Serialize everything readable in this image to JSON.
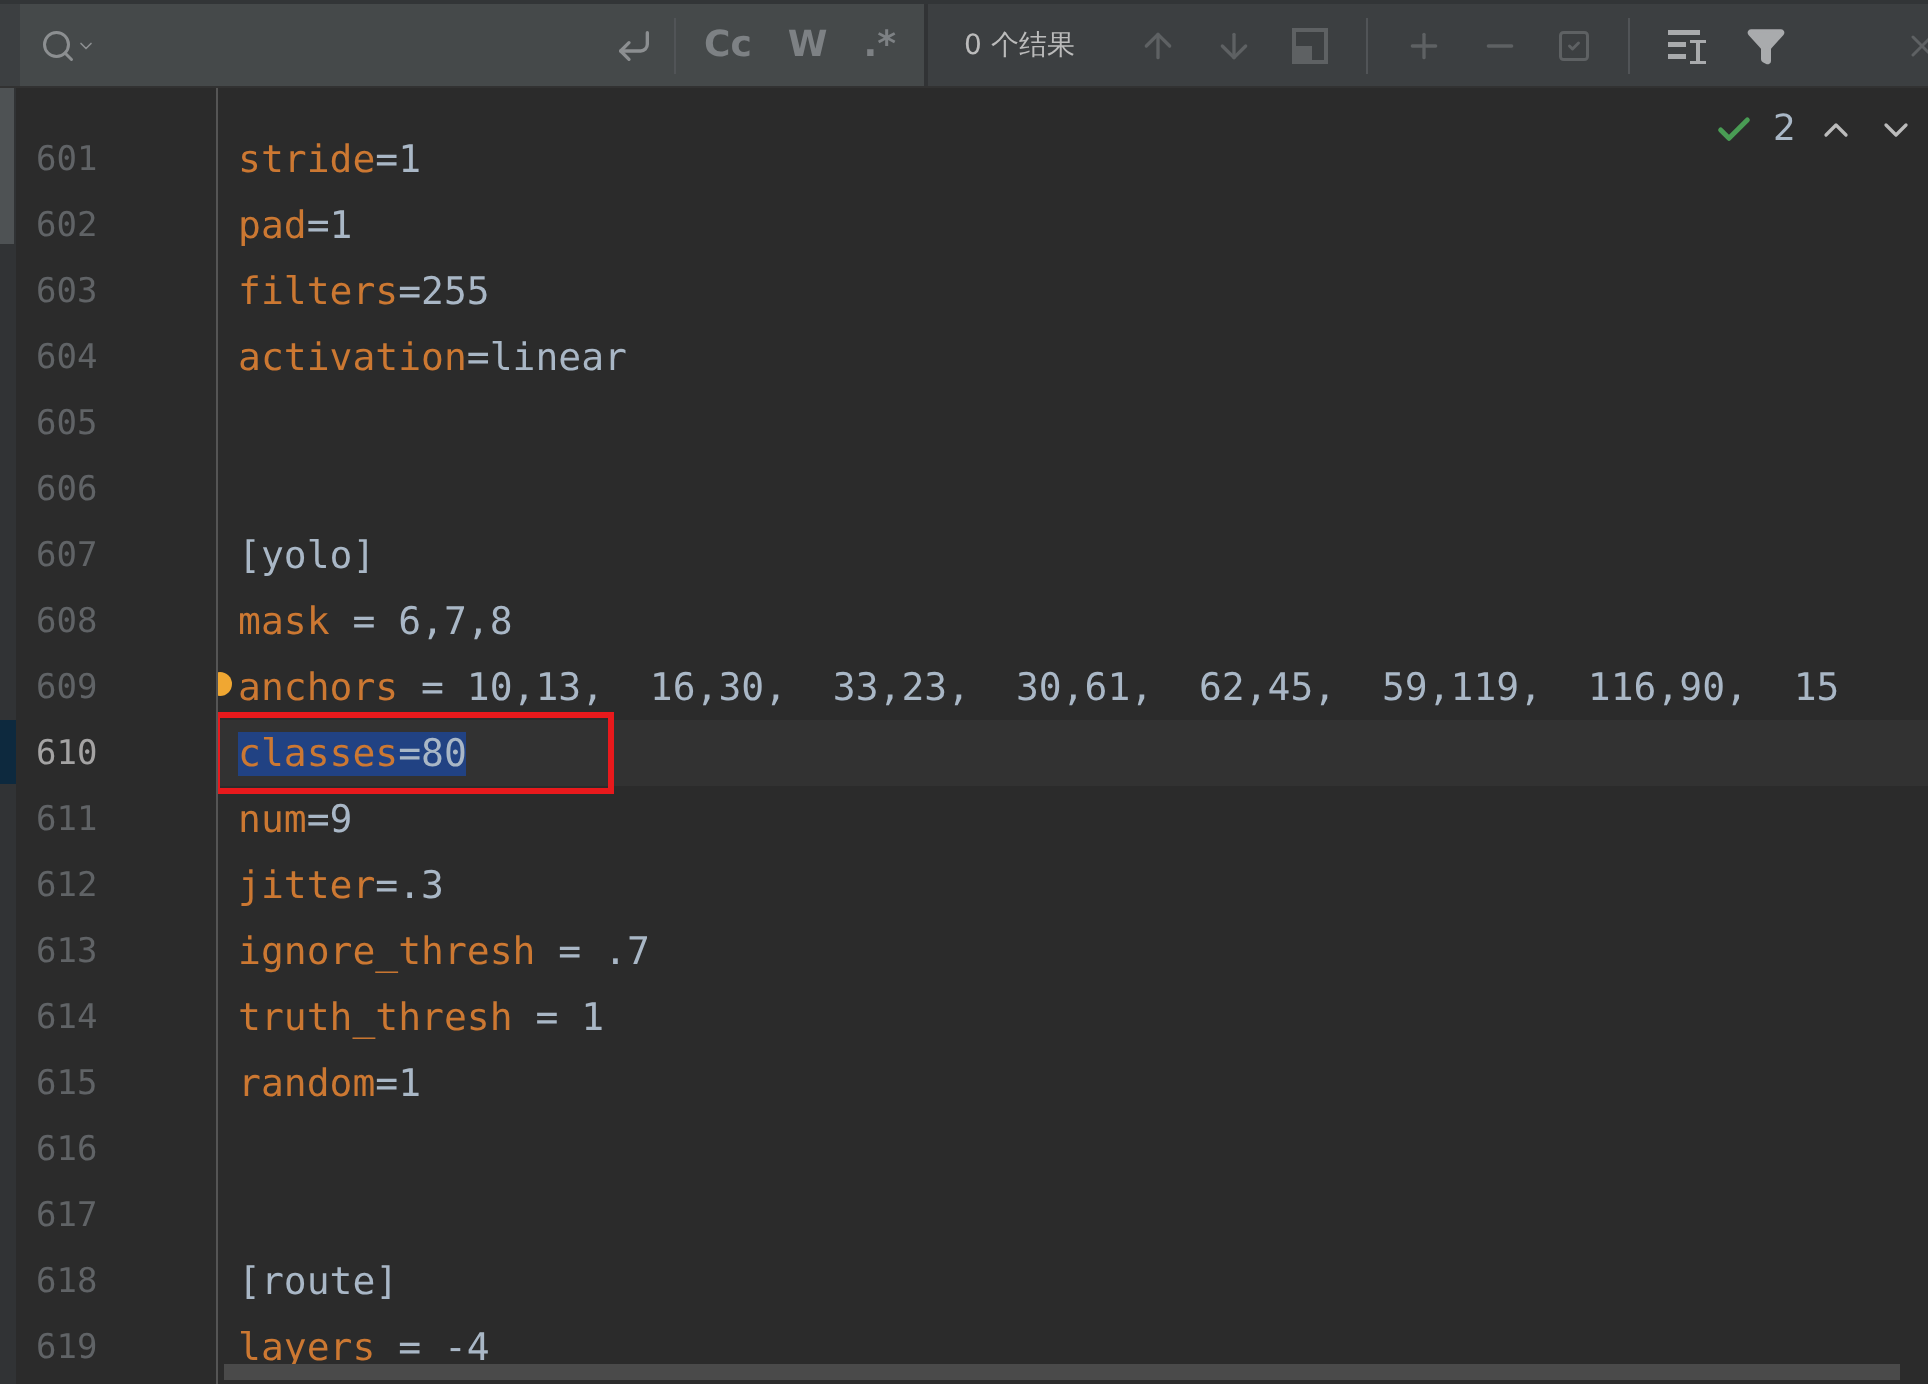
{
  "search_bar": {
    "toggles": [
      {
        "label": "Cc",
        "selected": false
      },
      {
        "label": "W",
        "selected": false
      },
      {
        "label": ".*",
        "selected": false
      }
    ],
    "result_count": "0 个结果"
  },
  "inspection": {
    "count": "2"
  },
  "lines": [
    {
      "number": "601",
      "kind": "pair",
      "key": "stride",
      "sep": "=",
      "value": "1",
      "current": false,
      "selected": false,
      "boxed": false,
      "bulb": false
    },
    {
      "number": "602",
      "kind": "pair",
      "key": "pad",
      "sep": "=",
      "value": "1",
      "current": false,
      "selected": false,
      "boxed": false,
      "bulb": false
    },
    {
      "number": "603",
      "kind": "pair",
      "key": "filters",
      "sep": "=",
      "value": "255",
      "current": false,
      "selected": false,
      "boxed": false,
      "bulb": false
    },
    {
      "number": "604",
      "kind": "pair",
      "key": "activation",
      "sep": "=",
      "value": "linear",
      "current": false,
      "selected": false,
      "boxed": false,
      "bulb": false
    },
    {
      "number": "605",
      "kind": "blank",
      "current": false,
      "selected": false,
      "boxed": false,
      "bulb": false
    },
    {
      "number": "606",
      "kind": "blank",
      "current": false,
      "selected": false,
      "boxed": false,
      "bulb": false
    },
    {
      "number": "607",
      "kind": "section",
      "value": "[yolo]",
      "current": false,
      "selected": false,
      "boxed": false,
      "bulb": false
    },
    {
      "number": "608",
      "kind": "pair",
      "key": "mask",
      "sep": " = ",
      "value": "6,7,8",
      "current": false,
      "selected": false,
      "boxed": false,
      "bulb": false
    },
    {
      "number": "609",
      "kind": "pair",
      "key": "anchors",
      "sep": " = ",
      "value": "10,13,  16,30,  33,23,  30,61,  62,45,  59,119,  116,90,  15",
      "current": false,
      "selected": false,
      "boxed": false,
      "bulb": true
    },
    {
      "number": "610",
      "kind": "pair",
      "key": "classes",
      "sep": "=",
      "value": "80",
      "current": true,
      "selected": true,
      "boxed": true,
      "bulb": false
    },
    {
      "number": "611",
      "kind": "pair",
      "key": "num",
      "sep": "=",
      "value": "9",
      "current": false,
      "selected": false,
      "boxed": false,
      "bulb": false
    },
    {
      "number": "612",
      "kind": "pair",
      "key": "jitter",
      "sep": "=",
      "value": ".3",
      "current": false,
      "selected": false,
      "boxed": false,
      "bulb": false
    },
    {
      "number": "613",
      "kind": "pair",
      "key": "ignore_thresh",
      "sep": " = ",
      "value": ".7",
      "current": false,
      "selected": false,
      "boxed": false,
      "bulb": false
    },
    {
      "number": "614",
      "kind": "pair",
      "key": "truth_thresh",
      "sep": " = ",
      "value": "1",
      "current": false,
      "selected": false,
      "boxed": false,
      "bulb": false
    },
    {
      "number": "615",
      "kind": "pair",
      "key": "random",
      "sep": "=",
      "value": "1",
      "current": false,
      "selected": false,
      "boxed": false,
      "bulb": false
    },
    {
      "number": "616",
      "kind": "blank",
      "current": false,
      "selected": false,
      "boxed": false,
      "bulb": false
    },
    {
      "number": "617",
      "kind": "blank",
      "current": false,
      "selected": false,
      "boxed": false,
      "bulb": false
    },
    {
      "number": "618",
      "kind": "section",
      "value": "[route]",
      "current": false,
      "selected": false,
      "boxed": false,
      "bulb": false
    },
    {
      "number": "619",
      "kind": "pair",
      "key": "layers",
      "sep": " = ",
      "value": "-4",
      "current": false,
      "selected": false,
      "boxed": false,
      "bulb": false
    }
  ]
}
